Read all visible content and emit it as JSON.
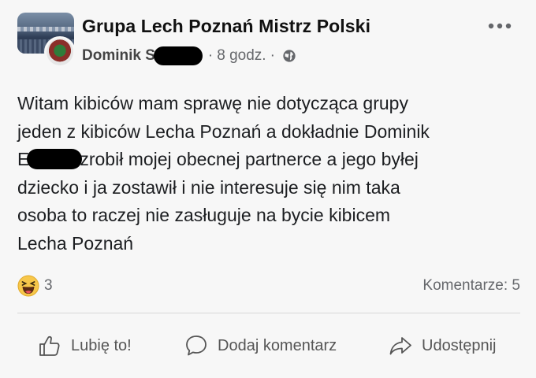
{
  "header": {
    "group_name": "Grupa Lech Poznań Mistrz Polski",
    "author_visible": "Dominik S",
    "time": "8 godz.",
    "separator": "·",
    "privacy_icon": "globe-icon",
    "more_icon": "more-options-icon"
  },
  "post": {
    "lines": [
      "Witam kibiców mam sprawę nie dotycząca grupy",
      "jeden z kibiców Lecha Poznań a dokładnie Dominik",
      "zrobił mojej obecnej  partnerce a jego byłej",
      "dziecko i ja zostawił i nie interesuje się nim taka",
      "osoba to raczej nie zasługuje na bycie kibicem",
      "Lecha Poznań"
    ],
    "line3_prefix": "E"
  },
  "reactions": {
    "icon": "haha-emoji-icon",
    "count": "3"
  },
  "comments": {
    "label": "Komentarze: 5"
  },
  "actions": {
    "like": "Lubię to!",
    "comment": "Dodaj komentarz",
    "share": "Udostępnij"
  },
  "colors": {
    "background": "#f7f7f7",
    "text": "#1c1e21",
    "secondary": "#65676b",
    "haha_yellow": "#f7c74a"
  }
}
